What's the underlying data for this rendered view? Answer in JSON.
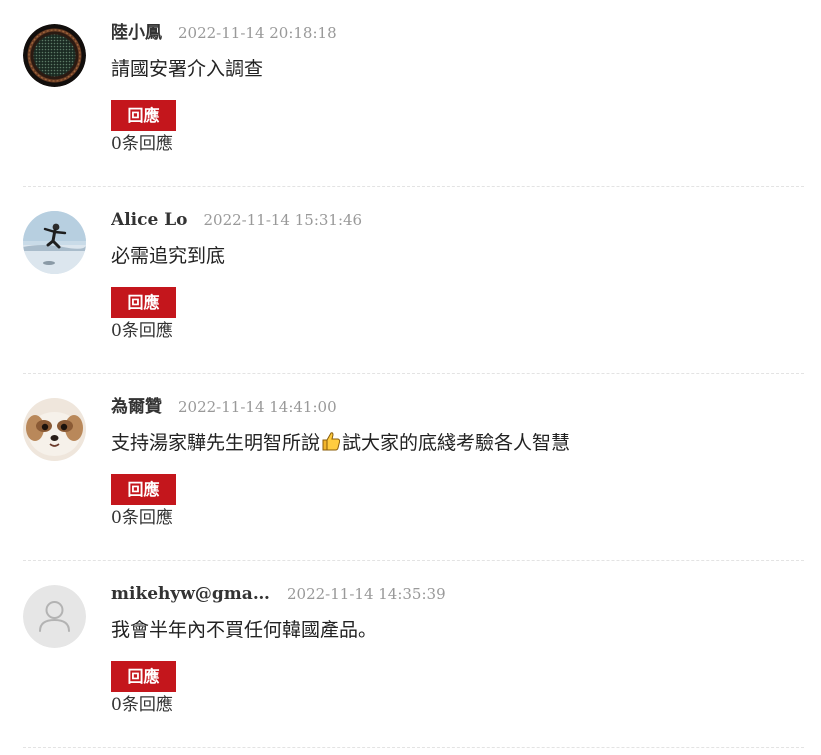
{
  "colors": {
    "reply_button_bg": "#c4161c",
    "timestamp": "#999999",
    "divider": "#e3e3e3"
  },
  "comments": [
    {
      "author": "陸小鳳",
      "time": "2022-11-14 20:18:18",
      "text": "請國安署介入調查",
      "reply_label": "回應",
      "reply_count": "0条回應",
      "avatar": "ornate-disc-avatar"
    },
    {
      "author": "Alice Lo",
      "time": "2022-11-14 15:31:46",
      "text": "必需追究到底",
      "reply_label": "回應",
      "reply_count": "0条回應",
      "avatar": "jumping-person-avatar"
    },
    {
      "author": "為爾贊",
      "time": "2022-11-14 14:41:00",
      "text_before": "支持湯家驊先生明智所說",
      "text_icon": "thumbs-up-emoji",
      "text_after": "試大家的底綫考驗各人智慧",
      "reply_label": "回應",
      "reply_count": "0条回應",
      "avatar": "dog-avatar"
    },
    {
      "author": "mikehyw@gmai…",
      "time": "2022-11-14 14:35:39",
      "text": "我會半年內不買任何韓國產品。",
      "reply_label": "回應",
      "reply_count": "0条回應",
      "avatar": "default-user-avatar"
    }
  ]
}
